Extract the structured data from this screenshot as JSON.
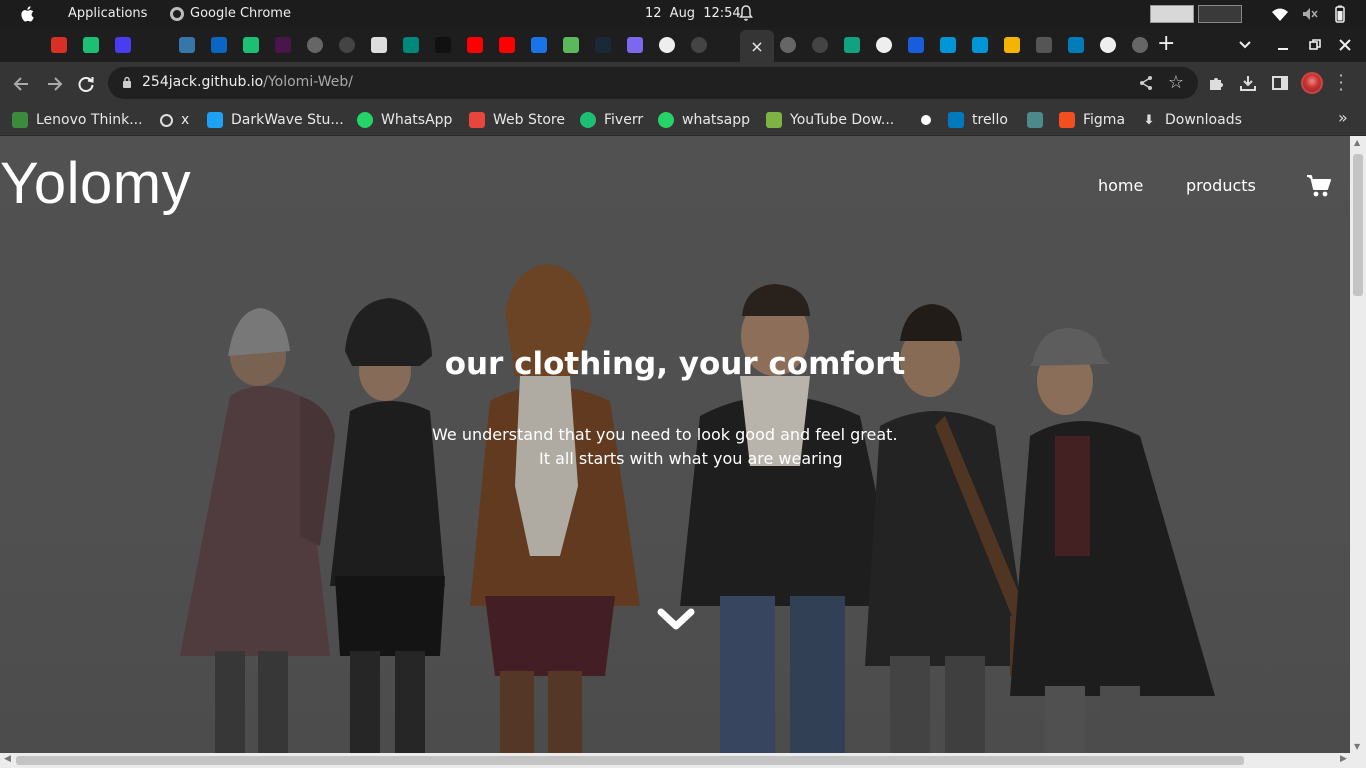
{
  "system_bar": {
    "applications_label": "Applications",
    "active_app": "Google Chrome",
    "date": "12 Aug",
    "time": "12:54"
  },
  "tabs": [
    {
      "icon": "alx-icon",
      "color": "#1e1e1e"
    },
    {
      "icon": "gmail-icon",
      "color": "#d93025"
    },
    {
      "icon": "fiverr-icon",
      "color": "#1dbf73"
    },
    {
      "icon": "upwork-icon",
      "color": "#4a3cf0"
    },
    {
      "icon": "alx-icon",
      "color": "#1e1e1e"
    },
    {
      "icon": "python-icon",
      "color": "#3776ab"
    },
    {
      "icon": "linkedin-icon",
      "color": "#0a66c2"
    },
    {
      "icon": "fiverr-icon",
      "color": "#1dbf73"
    },
    {
      "icon": "slack-icon",
      "color": "#4a154b"
    },
    {
      "icon": "globe-icon",
      "color": "#666666"
    },
    {
      "icon": "github-icon",
      "color": "#444444"
    },
    {
      "icon": "docs-icon",
      "color": "#dddddd"
    },
    {
      "icon": "meet-icon",
      "color": "#00897b"
    },
    {
      "icon": "pexels-icon",
      "color": "#111111"
    },
    {
      "icon": "youtube-icon",
      "color": "#ff0000"
    },
    {
      "icon": "youtube-icon",
      "color": "#ff0000"
    },
    {
      "icon": "todo-icon",
      "color": "#1a73e8"
    },
    {
      "icon": "check-icon",
      "color": "#5cb85c"
    },
    {
      "icon": "steam-icon",
      "color": "#1b2838"
    },
    {
      "icon": "az-icon",
      "color": "#7b68ee"
    },
    {
      "icon": "google-icon",
      "color": "#eeeeee"
    },
    {
      "icon": "github-icon",
      "color": "#444444"
    }
  ],
  "tabs_after": [
    {
      "icon": "globe-icon",
      "color": "#666666"
    },
    {
      "icon": "github-icon",
      "color": "#444444"
    },
    {
      "icon": "chatgpt-icon",
      "color": "#10a37f"
    },
    {
      "icon": "google-icon",
      "color": "#eeeeee"
    },
    {
      "icon": "bitwarden-icon",
      "color": "#175ddc"
    },
    {
      "icon": "hp-icon",
      "color": "#0096d6"
    },
    {
      "icon": "hp-icon",
      "color": "#0096d6"
    },
    {
      "icon": "dots-icon",
      "color": "#f4b400"
    },
    {
      "icon": "extension-icon",
      "color": "#555555"
    },
    {
      "icon": "dell-icon",
      "color": "#007db8"
    },
    {
      "icon": "google-icon",
      "color": "#eeeeee"
    },
    {
      "icon": "globe-icon",
      "color": "#666666"
    }
  ],
  "active_tab_close": "×",
  "address_bar": {
    "host": "254jack.github.io",
    "path": "/Yolomi-Web/"
  },
  "bookmarks": [
    {
      "label": "Lenovo Think...",
      "icon": "lenovo-icon",
      "color": "#3c8a3c"
    },
    {
      "label": "x",
      "icon": "history-icon",
      "color": "#353535"
    },
    {
      "label": "DarkWave Stu...",
      "icon": "darkwave-icon",
      "color": "#1da1f2"
    },
    {
      "label": "WhatsApp",
      "icon": "whatsapp-icon",
      "color": "#25d366"
    },
    {
      "label": "Web Store",
      "icon": "webstore-icon",
      "color": "#e8453c"
    },
    {
      "label": "Fiverr",
      "icon": "fiverr-icon",
      "color": "#1dbf73"
    },
    {
      "label": "whatsapp",
      "icon": "whatsapp-icon",
      "color": "#25d366"
    },
    {
      "label": "YouTube Dow...",
      "icon": "download-arrow-icon",
      "color": "#7cb342"
    },
    {
      "label": "",
      "icon": "globe-icon",
      "color": "#353535"
    },
    {
      "label": "trello",
      "icon": "trello-icon",
      "color": "#0079bf"
    },
    {
      "label": "",
      "icon": "codepen-icon",
      "color": "#4a8a8a"
    },
    {
      "label": "Figma",
      "icon": "figma-icon",
      "color": "#f24e1e"
    },
    {
      "label": "Downloads",
      "icon": "download-icon",
      "color": "#353535"
    }
  ],
  "page": {
    "logo": "Yolomy",
    "nav": {
      "home": "home",
      "products": "products"
    },
    "hero_title": "our clothing, your comfort",
    "hero_line1": "We understand that you need to look good and feel great.",
    "hero_line2": "It all starts with what you are wearing"
  }
}
